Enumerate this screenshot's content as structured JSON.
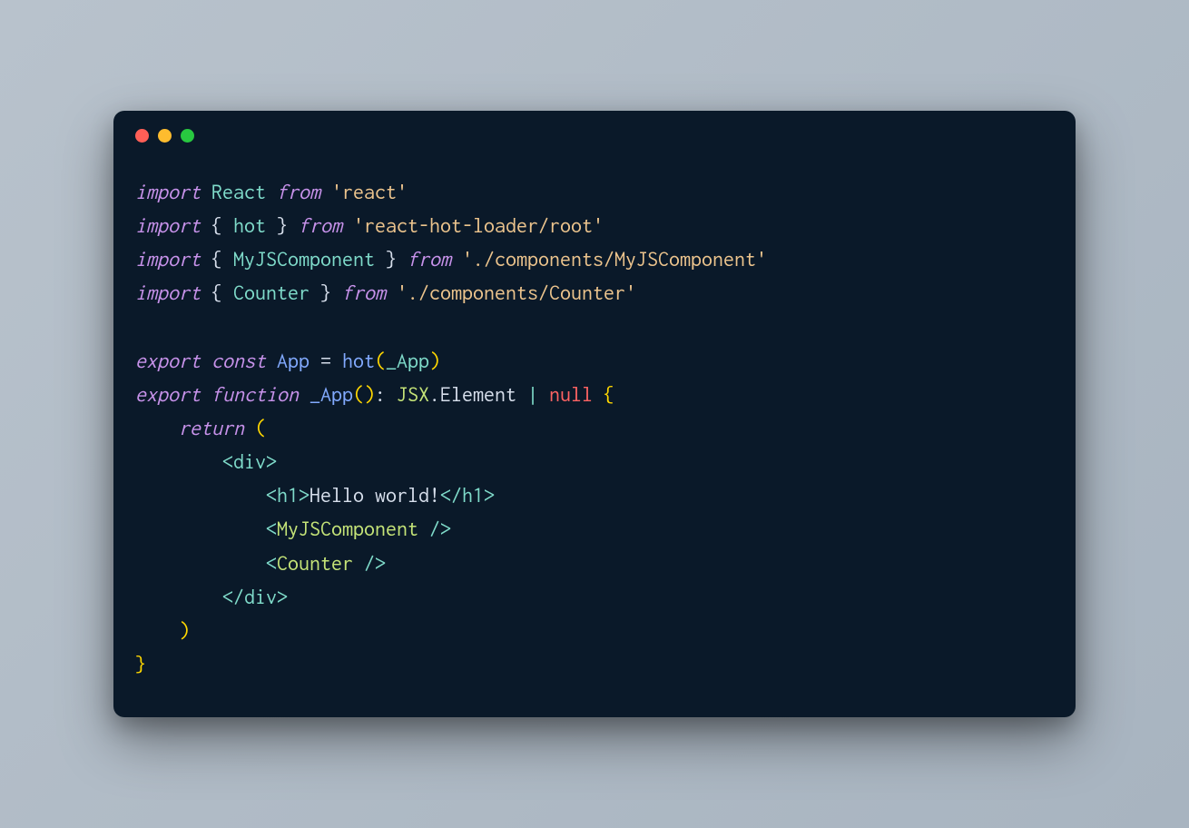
{
  "code": {
    "line1": {
      "import": "import",
      "react": "React",
      "from": "from",
      "str": "'react'"
    },
    "line2": {
      "import": "import",
      "lbrace": "{",
      "hot": "hot",
      "rbrace": "}",
      "from": "from",
      "str": "'react-hot-loader/root'"
    },
    "line3": {
      "import": "import",
      "lbrace": "{",
      "comp": "MyJSComponent",
      "rbrace": "}",
      "from": "from",
      "str": "'./components/MyJSComponent'"
    },
    "line4": {
      "import": "import",
      "lbrace": "{",
      "comp": "Counter",
      "rbrace": "}",
      "from": "from",
      "str": "'./components/Counter'"
    },
    "line6": {
      "export": "export",
      "const": "const",
      "app": "App",
      "eq": "=",
      "hot": "hot",
      "lparen": "(",
      "arg": "_App",
      "rparen": ")"
    },
    "line7": {
      "export": "export",
      "function": "function",
      "name": "_App",
      "lparen": "(",
      "rparen": ")",
      "colon": ":",
      "jsx": "JSX",
      "dot": ".",
      "element": "Element",
      "pipe": "|",
      "null": "null",
      "lbrace": "{"
    },
    "line8": {
      "return": "return",
      "lparen": "("
    },
    "line9": {
      "open": "<",
      "tag": "div",
      "close": ">"
    },
    "line10": {
      "open": "<",
      "tag": "h1",
      "close1": ">",
      "text": "Hello world!",
      "open2": "</",
      "tag2": "h1",
      "close2": ">"
    },
    "line11": {
      "open": "<",
      "tag": "MyJSComponent",
      "close": " />"
    },
    "line12": {
      "open": "<",
      "tag": "Counter",
      "close": " />"
    },
    "line13": {
      "open": "</",
      "tag": "div",
      "close": ">"
    },
    "line14": {
      "rparen": ")"
    },
    "line15": {
      "rbrace": "}"
    }
  }
}
